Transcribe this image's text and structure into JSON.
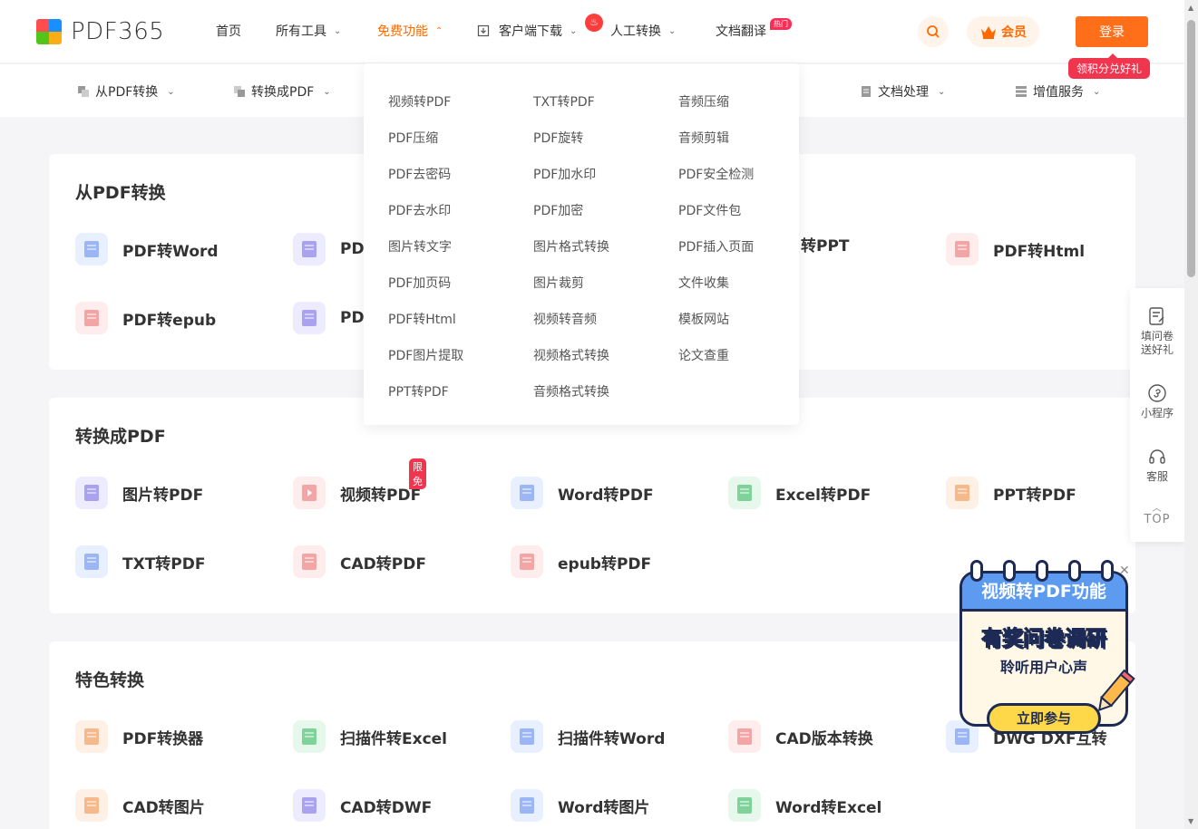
{
  "brand": {
    "name": "PDF365",
    "colors": [
      "#ff4d4f",
      "#1890ff",
      "#52c41a",
      "#faad14"
    ]
  },
  "nav": {
    "items": [
      {
        "label": "首页"
      },
      {
        "label": "所有工具"
      },
      {
        "label": "免费功能"
      },
      {
        "label": "客户端下载"
      },
      {
        "label": "人工转换"
      },
      {
        "label": "文档翻译",
        "tag": "热门"
      }
    ]
  },
  "header": {
    "vip_label": "会员",
    "login_label": "登录",
    "gift_label": "领积分兑好礼"
  },
  "subnav": {
    "items": [
      {
        "label": "从PDF转换"
      },
      {
        "label": "转换成PDF"
      },
      {
        "label": "文档处理"
      },
      {
        "label": "增值服务"
      }
    ]
  },
  "dropdown": {
    "col1": [
      "视频转PDF",
      "PDF压缩",
      "PDF去密码",
      "PDF去水印",
      "图片转文字",
      "PDF加页码",
      "PDF转Html",
      "PDF图片提取",
      "PPT转PDF"
    ],
    "col2": [
      "TXT转PDF",
      "PDF旋转",
      "PDF加水印",
      "PDF加密",
      "图片格式转换",
      "图片裁剪",
      "视频转音频",
      "视频格式转换",
      "音频格式转换"
    ],
    "col3": [
      "音频压缩",
      "音频剪辑",
      "PDF安全检测",
      "PDF文件包",
      "PDF插入页面",
      "文件收集",
      "模板网站",
      "论文查重"
    ]
  },
  "section1": {
    "title": "从PDF转换",
    "row1": [
      "PDF转Word",
      "PDF",
      "",
      "转PPT",
      "PDF转Html"
    ],
    "row2": [
      "PDF转epub",
      "PDF"
    ]
  },
  "section2": {
    "title": "转换成PDF",
    "limit_tag": "限免",
    "row1": [
      "图片转PDF",
      "视频转PDF",
      "Word转PDF",
      "Excel转PDF",
      "PPT转PDF"
    ],
    "row2": [
      "TXT转PDF",
      "CAD转PDF",
      "epub转PDF"
    ]
  },
  "section3": {
    "title": "特色转换",
    "row1": [
      "PDF转换器",
      "扫描件转Excel",
      "扫描件转Word",
      "CAD版本转换",
      "DWG DXF互转"
    ],
    "row2": [
      "CAD转图片",
      "CAD转DWF",
      "Word转图片",
      "Word转Excel"
    ]
  },
  "sidebar": {
    "survey": "填问卷送好礼",
    "mini": "小程序",
    "service": "客服",
    "top": "TOP"
  },
  "promo": {
    "head": "视频转PDF功能",
    "line1": "有奖问卷调研",
    "line2": "聆听用户心声",
    "button": "立即参与"
  }
}
